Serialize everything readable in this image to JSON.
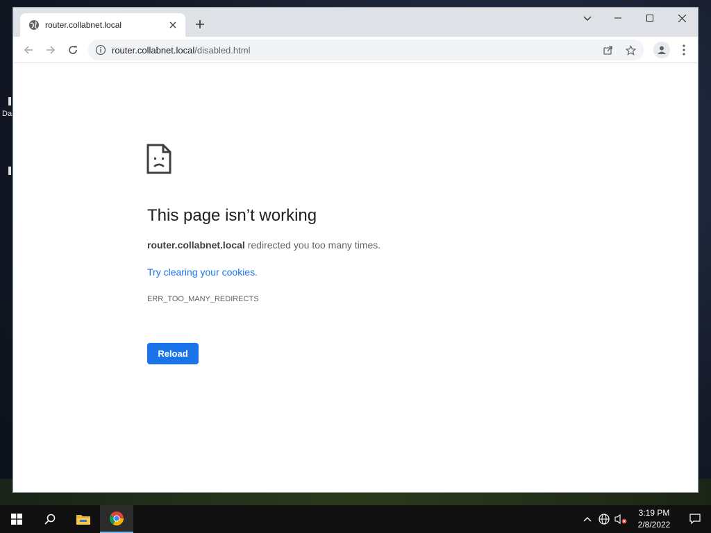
{
  "desktop": {
    "fragment_label": "Da"
  },
  "browser": {
    "tab": {
      "title": "router.collabnet.local",
      "icon": "globe-icon",
      "close_icon": "close-icon"
    },
    "new_tab_icon": "plus-icon",
    "window_controls": [
      "tab-search-icon",
      "minimize-icon",
      "maximize-icon",
      "close-icon"
    ],
    "address_bar": {
      "host": "router.collabnet.local",
      "path": "/disabled.html",
      "icon": "info-icon"
    },
    "toolbar_icons": [
      "back-arrow-icon",
      "forward-arrow-icon",
      "reload-icon",
      "share-icon",
      "star-icon",
      "profile-icon",
      "kebab-menu-icon"
    ]
  },
  "error_page": {
    "icon": "sad-document-icon",
    "title": "This page isn’t working",
    "host": "router.collabnet.local",
    "message": " redirected you too many times.",
    "link": "Try clearing your cookies.",
    "code": "ERR_TOO_MANY_REDIRECTS",
    "button": "Reload"
  },
  "taskbar": {
    "items": [
      "windows-start-icon",
      "search-icon",
      "file-explorer-icon",
      "chrome-icon"
    ],
    "tray_icons": [
      "chevron-up-icon",
      "network-globe-icon",
      "speaker-muted-icon"
    ],
    "time": "3:19 PM",
    "date": "2/8/2022",
    "notification_icon": "notification-icon"
  },
  "colors": {
    "accent": "#1a73e8",
    "tabstrip": "#dee1e6",
    "taskbar": "#101010"
  }
}
